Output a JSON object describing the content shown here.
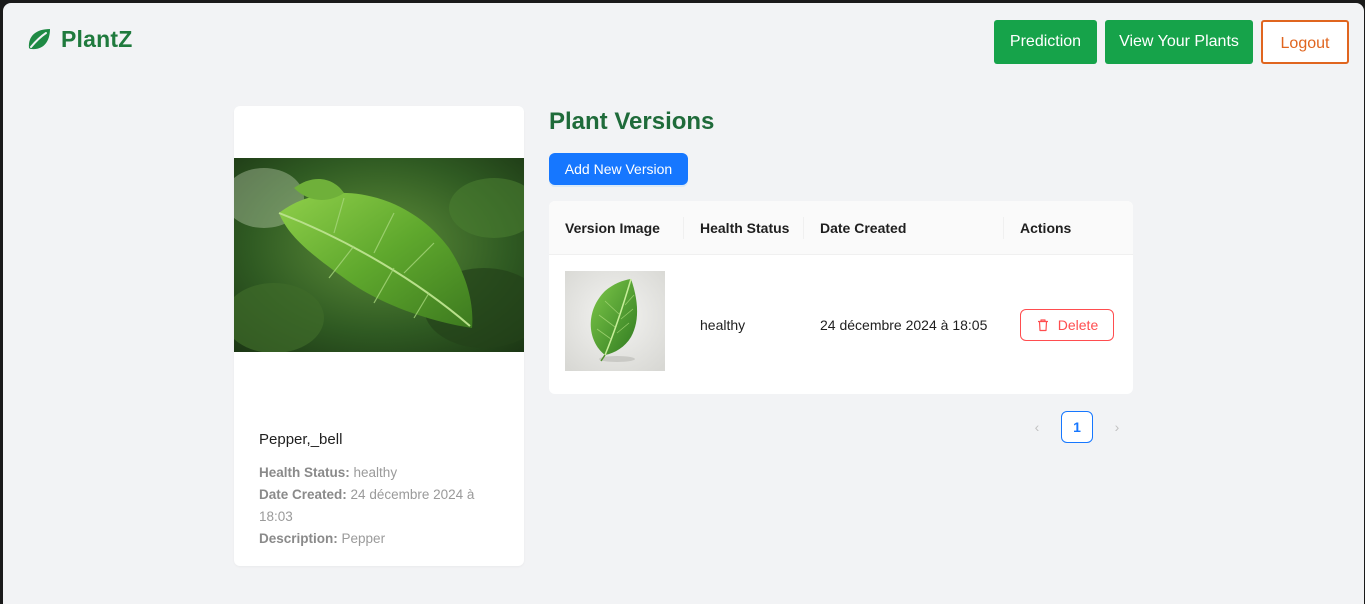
{
  "header": {
    "brand": "PlantZ",
    "nav": {
      "prediction": "Prediction",
      "view_plants": "View Your Plants",
      "logout": "Logout"
    }
  },
  "plant": {
    "name": "Pepper,_bell",
    "health_label": "Health Status:",
    "health_value": "healthy",
    "date_label": "Date Created:",
    "date_value": "24 décembre 2024 à 18:03",
    "description_label": "Description:",
    "description_value": "Pepper"
  },
  "versions": {
    "title": "Plant Versions",
    "add_button": "Add New Version",
    "columns": [
      "Version Image",
      "Health Status",
      "Date Created",
      "Actions"
    ],
    "rows": [
      {
        "health": "healthy",
        "date": "24 décembre 2024 à 18:05",
        "action": "Delete"
      }
    ],
    "pagination": {
      "current_page": "1",
      "prev": "‹",
      "next": "›"
    }
  },
  "colors": {
    "brand_green": "#16a34a",
    "title_green": "#1f6b3a",
    "logout_orange": "#e0651f",
    "primary_blue": "#1677ff",
    "danger_red": "#ff4d4f"
  }
}
